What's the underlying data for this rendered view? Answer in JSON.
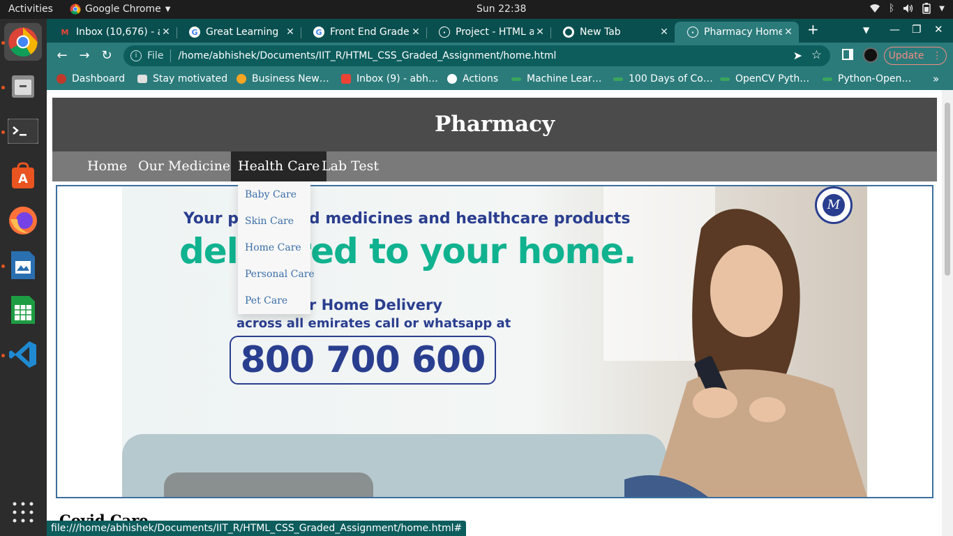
{
  "system": {
    "activities": "Activities",
    "app_name": "Google Chrome",
    "clock": "Sun 22:38"
  },
  "dock": {
    "apps": [
      "chrome-icon",
      "files-icon",
      "terminal-icon",
      "software-center-icon",
      "firefox-icon",
      "writer-icon",
      "calc-icon",
      "vscode-icon",
      "app-grid-icon"
    ]
  },
  "browser": {
    "tabs": [
      {
        "title": "Inbox (10,676) - a",
        "icon": "gmail-icon"
      },
      {
        "title": "Great Learning",
        "icon": "google-icon"
      },
      {
        "title": "Front End Grade",
        "icon": "google-icon"
      },
      {
        "title": "Project - HTML a",
        "icon": "globe-icon"
      },
      {
        "title": "New Tab",
        "icon": "chrome-icon"
      },
      {
        "title": "Pharmacy Home",
        "icon": "globe-icon"
      }
    ],
    "address": {
      "scheme": "File",
      "url": "/home/abhishek/Documents/IIT_R/HTML_CSS_Graded_Assignment/home.html"
    },
    "update_label": "Update",
    "bookmarks": [
      {
        "label": "Dashboard",
        "icon": "dashboard-icon"
      },
      {
        "label": "Stay motivated",
        "icon": "folder-icon"
      },
      {
        "label": "Business New…",
        "icon": "business-news-icon"
      },
      {
        "label": "Inbox (9) - abh…",
        "icon": "gmail-icon"
      },
      {
        "label": "Actions",
        "icon": "globe-icon"
      },
      {
        "label": "Machine Lear…",
        "icon": "link-icon"
      },
      {
        "label": "100 Days of Co…",
        "icon": "link-icon"
      },
      {
        "label": "OpenCV Pyth…",
        "icon": "link-icon"
      },
      {
        "label": "Python-Open…",
        "icon": "link-icon"
      }
    ],
    "status_url": "file:///home/abhishek/Documents/IIT_R/HTML_CSS_Graded_Assignment/home.html#"
  },
  "page": {
    "title": "Pharmacy",
    "nav": [
      "Home",
      "Our Medicines",
      "Health Care",
      "Lab Test"
    ],
    "dropdown": [
      "Baby Care",
      "Skin Care",
      "Home Care",
      "Personal Care",
      "Pet Care"
    ],
    "banner": {
      "line1": "Your prescribed medicines and healthcare products",
      "line2": "delivered to your home.",
      "line3": "For Home Delivery",
      "line4": "across all emirates call or whatsapp at",
      "phone": "800 700 600"
    },
    "section_title": "Covid Care"
  },
  "colors": {
    "chrome_tabstrip": "#0a4f4f",
    "chrome_toolbar": "#2b7b7b",
    "site_header": "#4b4b4b",
    "site_nav": "#7a7a7a",
    "nav_active": "#262626",
    "link": "#3a6ea8",
    "banner_blue": "#2a3e8f",
    "banner_green": "#10b28f"
  }
}
